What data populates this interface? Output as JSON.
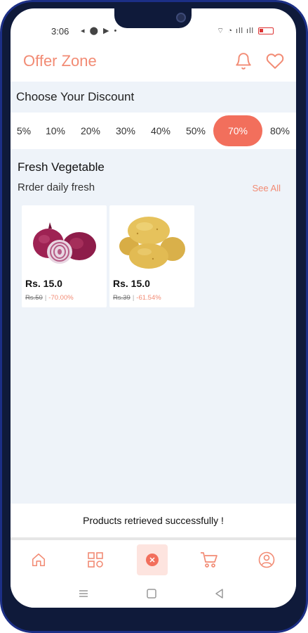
{
  "status_bar": {
    "time": "3:06",
    "left_icons": "◂ ⬤ ▶ •",
    "right_icons": "⌔ ◔ ıll ıll"
  },
  "header": {
    "title": "Offer Zone",
    "icons": [
      "bell-icon",
      "heart-icon"
    ],
    "accent_color": "#f28b74"
  },
  "discount": {
    "title": "Choose Your Discount",
    "options": [
      "5%",
      "10%",
      "20%",
      "30%",
      "40%",
      "50%",
      "70%",
      "80%"
    ],
    "selected": "70%",
    "active_color": "#f26f5c"
  },
  "section": {
    "title": "Fresh Vegetable",
    "subtitle": "Rrder daily fresh",
    "see_all": "See All"
  },
  "products": [
    {
      "name_icon": "onion-image",
      "price": "Rs. 15.0",
      "old_price": "Rs.50",
      "discount": "-70.00%"
    },
    {
      "name_icon": "potato-image",
      "price": "Rs. 15.0",
      "old_price": "Rs.39",
      "discount": "-61.54%"
    }
  ],
  "toast": {
    "message": "Products retrieved successfully !"
  },
  "bottom_nav": {
    "items": [
      "home-icon",
      "categories-icon",
      "offer-icon",
      "cart-icon",
      "profile-icon"
    ],
    "active": "offer-icon"
  },
  "system_nav": [
    "menu-icon",
    "home-square-icon",
    "back-icon"
  ]
}
